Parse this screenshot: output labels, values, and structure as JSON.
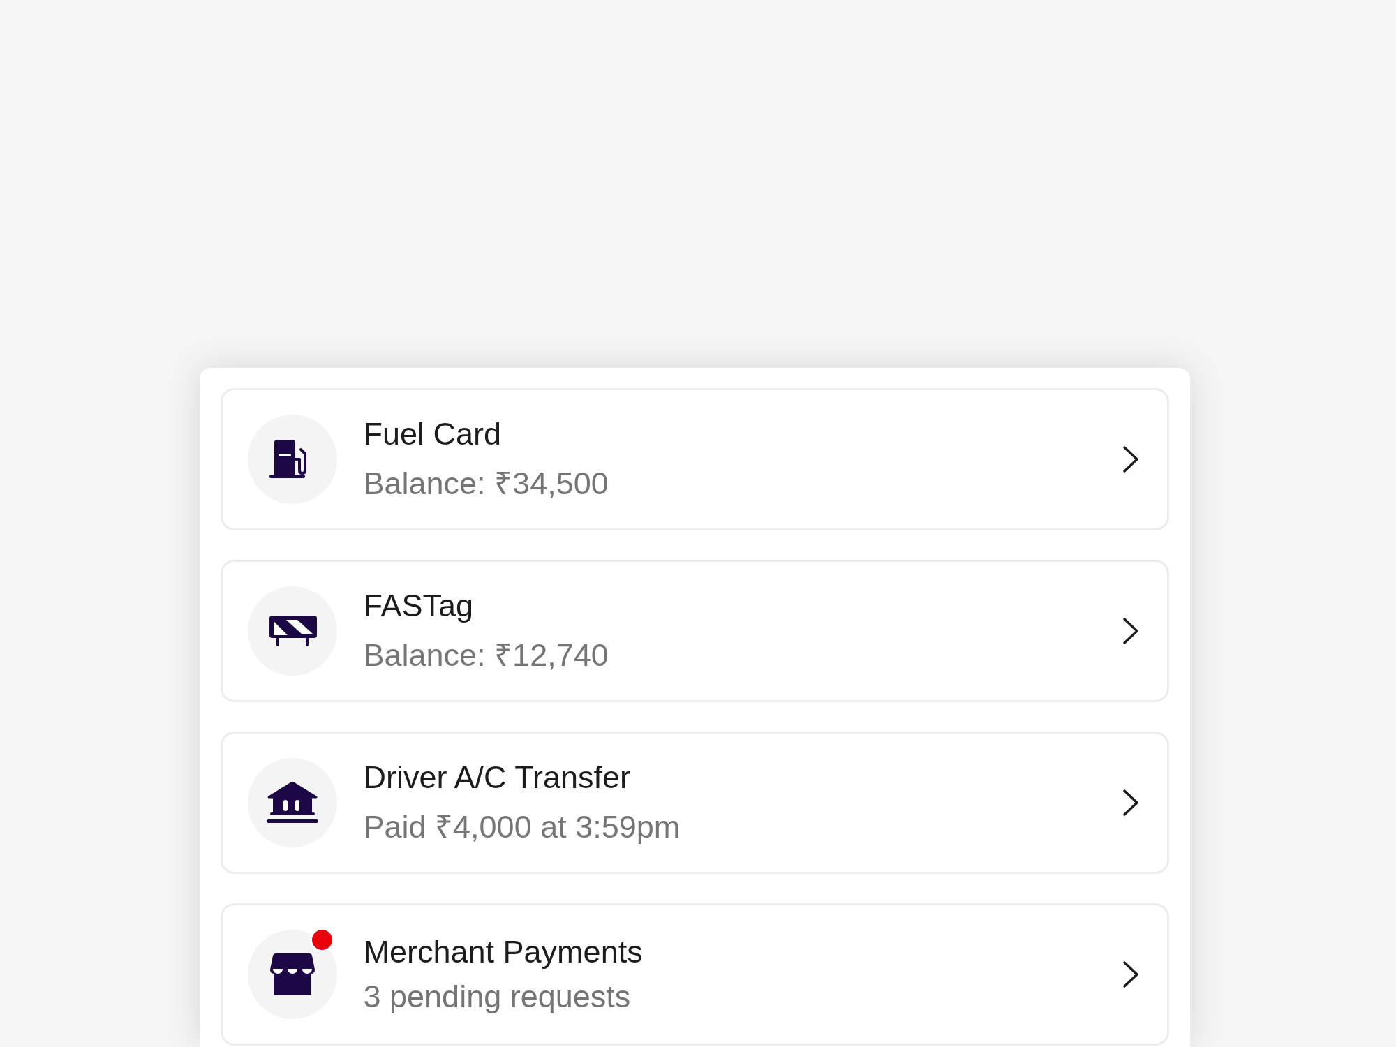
{
  "items": [
    {
      "kind": "fuel",
      "title": "Fuel Card",
      "subtitle": "Balance: ₹34,500",
      "badge": false
    },
    {
      "kind": "fastag",
      "title": "FASTag",
      "subtitle": "Balance: ₹12,740",
      "badge": false
    },
    {
      "kind": "bank",
      "title": "Driver A/C Transfer",
      "subtitle": "Paid ₹4,000 at 3:59pm",
      "badge": false
    },
    {
      "kind": "shop",
      "title": "Merchant Payments",
      "subtitle": "3 pending requests",
      "badge": true
    }
  ]
}
